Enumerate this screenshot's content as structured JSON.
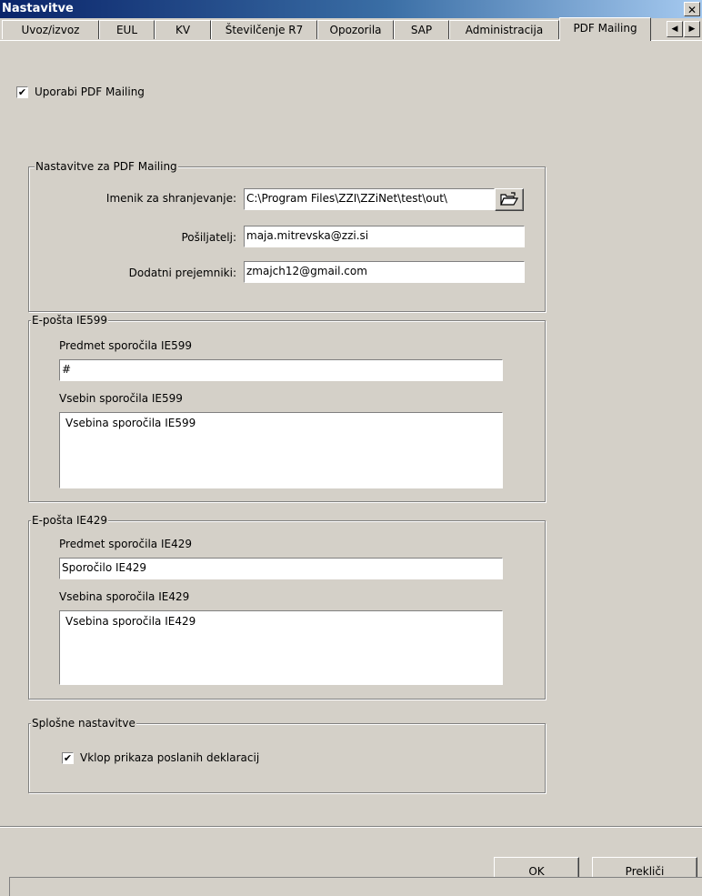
{
  "window": {
    "title": "Nastavitve",
    "close_glyph": "✕"
  },
  "tabs": [
    {
      "label": "Uvoz/izvoz"
    },
    {
      "label": "EUL"
    },
    {
      "label": "KV"
    },
    {
      "label": "Številčenje R7"
    },
    {
      "label": "Opozorila"
    },
    {
      "label": "SAP"
    },
    {
      "label": "Administracija"
    },
    {
      "label": "PDF Mailing",
      "active": true
    }
  ],
  "tab_scroll": {
    "left": "◀",
    "right": "▶"
  },
  "use_pdf_mailing": {
    "label": "Uporabi PDF Mailing",
    "checked": true,
    "mark": "✔"
  },
  "pdf_settings": {
    "legend": "Nastavitve za PDF Mailing",
    "dir_label": "Imenik za shranjevanje:",
    "dir_value": "C:\\Program Files\\ZZI\\ZZiNet\\test\\out\\",
    "browse_icon": "folder-open-icon",
    "sender_label": "Pošiljatelj:",
    "sender_value": "maja.mitrevska@zzi.si",
    "extra_label": "Dodatni prejemniki:",
    "extra_value": "zmajch12@gmail.com"
  },
  "ie599": {
    "legend": "E-pošta IE599",
    "subject_label": "Predmet sporočila IE599",
    "subject_value": "#",
    "body_label": "Vsebin sporočila IE599",
    "body_value": "Vsebina sporočila IE599"
  },
  "ie429": {
    "legend": "E-pošta IE429",
    "subject_label": "Predmet sporočila IE429",
    "subject_value": "Sporočilo IE429",
    "body_label": "Vsebina sporočila IE429",
    "body_value": "Vsebina sporočila IE429"
  },
  "general": {
    "legend": "Splošne nastavitve",
    "show_sent_label": "Vklop prikaza poslanih deklaracij",
    "show_sent_checked": true,
    "mark": "✔"
  },
  "buttons": {
    "ok": "OK",
    "cancel": "Prekliči"
  }
}
